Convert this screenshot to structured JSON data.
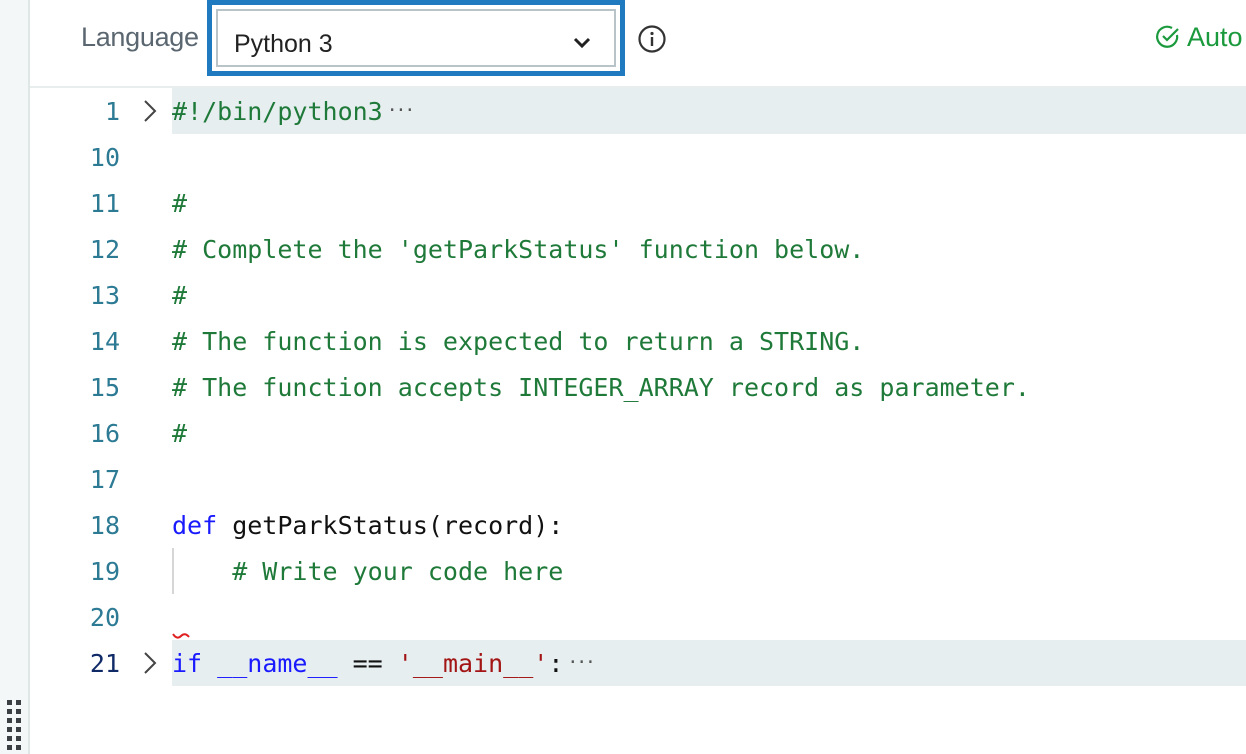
{
  "toolbar": {
    "language_label": "Language",
    "language_selected": "Python 3",
    "info_icon": "info-icon",
    "autosave_label": "Auto",
    "autosave_icon": "check-circle-icon"
  },
  "editor": {
    "lines": [
      {
        "number": "1",
        "text": "#!/bin/python3",
        "folded": true
      },
      {
        "number": "10",
        "text": ""
      },
      {
        "number": "11",
        "text": "#"
      },
      {
        "number": "12",
        "text": "# Complete the 'getParkStatus' function below."
      },
      {
        "number": "13",
        "text": "#"
      },
      {
        "number": "14",
        "text": "# The function is expected to return a STRING."
      },
      {
        "number": "15",
        "text": "# The function accepts INTEGER_ARRAY record as parameter."
      },
      {
        "number": "16",
        "text": "#"
      },
      {
        "number": "17",
        "text": ""
      },
      {
        "number": "18",
        "keyword": "def",
        "text": " getParkStatus(record):"
      },
      {
        "number": "19",
        "text": "    # Write your code here"
      },
      {
        "number": "20",
        "text": ""
      },
      {
        "number": "21",
        "keyword": "if",
        "name_part": " __name__",
        "op": " == ",
        "string": "'__main__'",
        "tail": ":",
        "folded": true
      }
    ],
    "fold_ellipsis": "···"
  }
}
